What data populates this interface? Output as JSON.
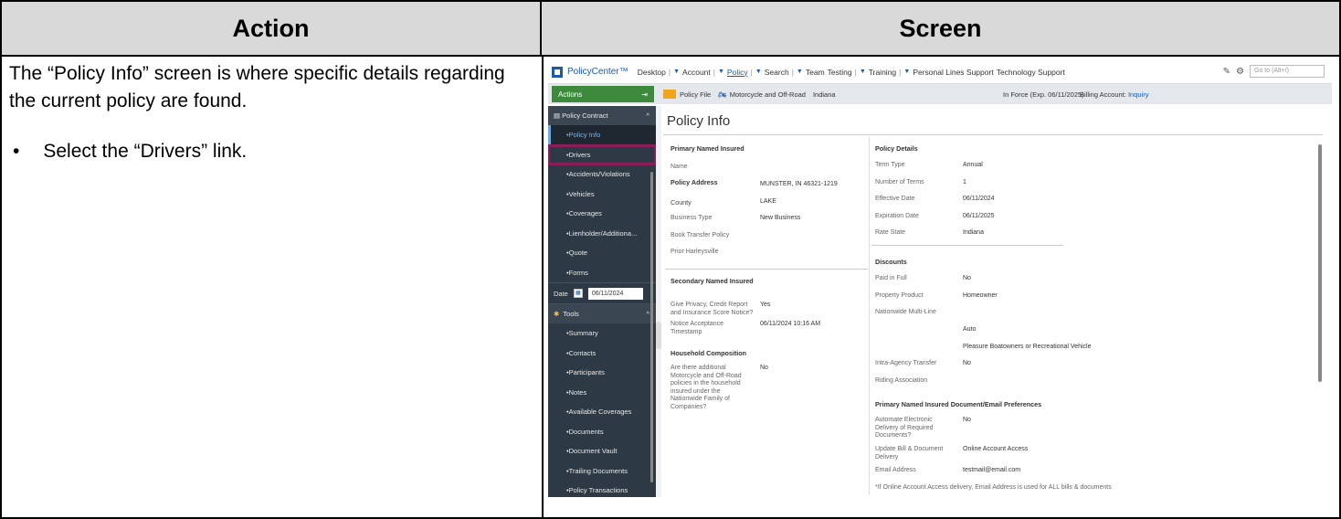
{
  "table": {
    "header_action": "Action",
    "header_screen": "Screen",
    "action_text": "The “Policy Info” screen is where specific details regarding the current policy are found.",
    "bullet_symbol": "•",
    "bullet_text": "Select the “Drivers” link."
  },
  "app": {
    "brand": "PolicyCenter™",
    "nav": [
      "Desktop",
      "Account",
      "Policy",
      "Search",
      "Team",
      "Testing",
      "Training",
      "Personal Lines Support",
      "Technology Support"
    ],
    "goto_placeholder": "Go to (Alt+/)",
    "infobar": {
      "actions_label": "Actions",
      "policy_file": "Policy File",
      "product": "Motorcycle and Off-Road",
      "state": "Indiana",
      "status": "In Force (Exp. 06/11/2025)",
      "billing_label": "Billing Account:",
      "billing_link": "Inquiry"
    },
    "sidebar": {
      "policy_contract": "Policy Contract",
      "items": [
        "Policy Info",
        "Drivers",
        "Accidents/Violations",
        "Vehicles",
        "Coverages",
        "Lienholder/Additiona...",
        "Quote",
        "Forms"
      ],
      "date_label": "Date",
      "date_value": "06/11/2024",
      "tools": "Tools",
      "tool_items": [
        "Summary",
        "Contacts",
        "Participants",
        "Notes",
        "Available Coverages",
        "Documents",
        "Document Vault",
        "Trailing Documents",
        "Policy Transactions"
      ]
    },
    "page_title": "Policy Info",
    "left": {
      "primary_named_insured": "Primary Named Insured",
      "name_label": "Name",
      "policy_address_label": "Policy Address",
      "policy_address_value": "MUNSTER, IN 46321-1219",
      "county_label": "County",
      "county_value": "LAKE",
      "business_type_label": "Business Type",
      "business_type_value": "New Business",
      "book_transfer_label": "Book Transfer Policy",
      "prior_harleysville_label": "Prior Harleysville",
      "secondary_named_insured": "Secondary Named Insured",
      "give_privacy_label": "Give Privacy, Credit Report and Insurance Score Notice?",
      "give_privacy_value": "Yes",
      "notice_label": "Notice Acceptance Timestamp",
      "notice_value": "06/11/2024 10:16 AM",
      "household_composition": "Household Composition",
      "household_label": "Are there additional Motorcycle and Off-Road policies in the household insured under the Nationwide Family of Companies?",
      "household_value": "No"
    },
    "right": {
      "policy_details": "Policy Details",
      "term_type_label": "Term Type",
      "term_type_value": "Annual",
      "number_terms_label": "Number of Terms",
      "number_terms_value": "1",
      "effective_label": "Effective Date",
      "effective_value": "06/11/2024",
      "expiration_label": "Expiration Date",
      "expiration_value": "06/11/2025",
      "rate_state_label": "Rate State",
      "rate_state_value": "Indiana",
      "discounts": "Discounts",
      "paid_full_label": "Paid in Full",
      "paid_full_value": "No",
      "property_label": "Property Product",
      "property_value": "Homeowner",
      "multiline_label": "Nationwide Multi-Line",
      "multiline_value_1": "Auto",
      "multiline_value_2": "Pleasure Boatowners or Recreational Vehicle",
      "intra_agency_label": "Intra-Agency Transfer",
      "intra_agency_value": "No",
      "riding_label": "Riding Association",
      "doc_prefs": "Primary Named Insured Document/Email Preferences",
      "auto_delivery_label": "Automate Electronic Delivery of Required Documents?",
      "auto_delivery_value": "No",
      "update_bill_label": "Update Bill & Document Delivery",
      "update_bill_value": "Online Account Access",
      "email_label": "Email Address",
      "email_value": "testmail@email.com",
      "footnote": "*If Online Account Access delivery, Email Address is used for ALL bills & documents"
    }
  }
}
